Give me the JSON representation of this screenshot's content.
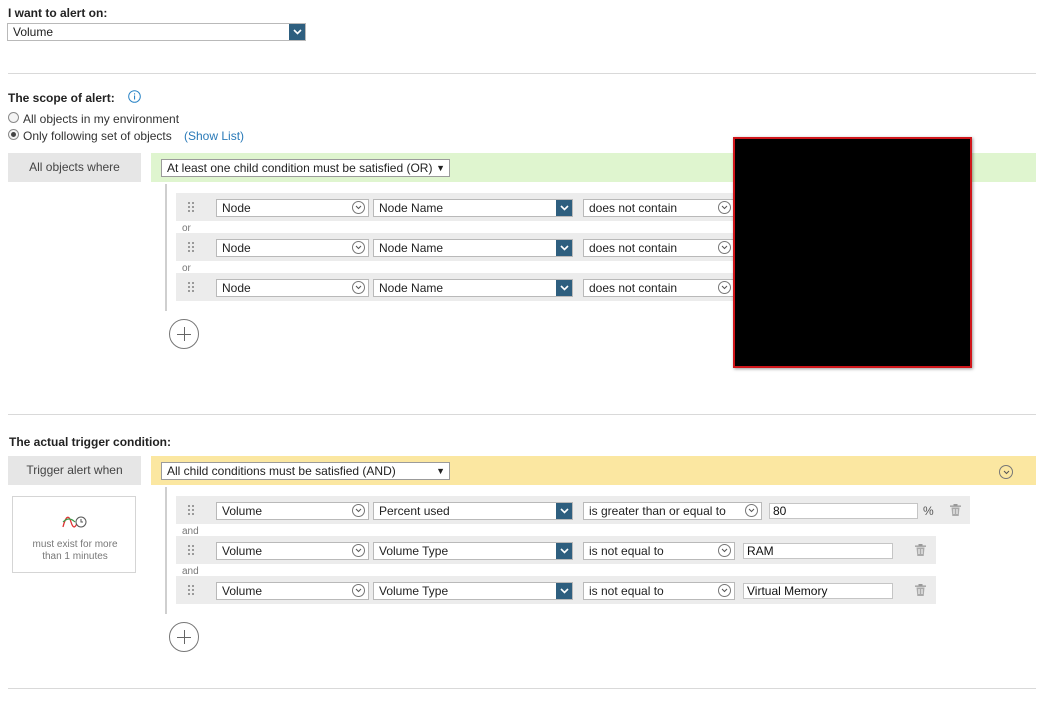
{
  "alert_on": {
    "label": "I want to alert on:",
    "value": "Volume"
  },
  "scope": {
    "title": "The scope of alert:",
    "radio_all": "All objects in my environment",
    "radio_following": "Only following set of objects",
    "show_list": "(Show List)",
    "selected": "following",
    "all_objects_where": "All objects where",
    "group_select": "At least one child condition must be satisfied (OR)",
    "connector": "or",
    "rows": [
      {
        "field": "Node",
        "property": "Node Name",
        "operator": "does not contain"
      },
      {
        "field": "Node",
        "property": "Node Name",
        "operator": "does not contain"
      },
      {
        "field": "Node",
        "property": "Node Name",
        "operator": "does not contain"
      }
    ]
  },
  "trigger": {
    "title": "The actual trigger condition:",
    "trigger_when": "Trigger alert when",
    "group_select": "All child conditions must be satisfied (AND)",
    "duration_text": "must exist for more than 1 minutes",
    "connector": "and",
    "rows": [
      {
        "field": "Volume",
        "property": "Percent used",
        "operator": "is greater than or equal to",
        "value": "80",
        "unit": "%"
      },
      {
        "field": "Volume",
        "property": "Volume Type",
        "operator": "is not equal to",
        "value": "RAM",
        "unit": ""
      },
      {
        "field": "Volume",
        "property": "Volume Type",
        "operator": "is not equal to",
        "value": "Virtual Memory",
        "unit": ""
      }
    ]
  },
  "colors": {
    "or_band": "#dff5cf",
    "and_band": "#fbe7a1",
    "select_button": "#2e5f7f",
    "info": "#2a84c6",
    "redacted_border": "#d0161b"
  }
}
